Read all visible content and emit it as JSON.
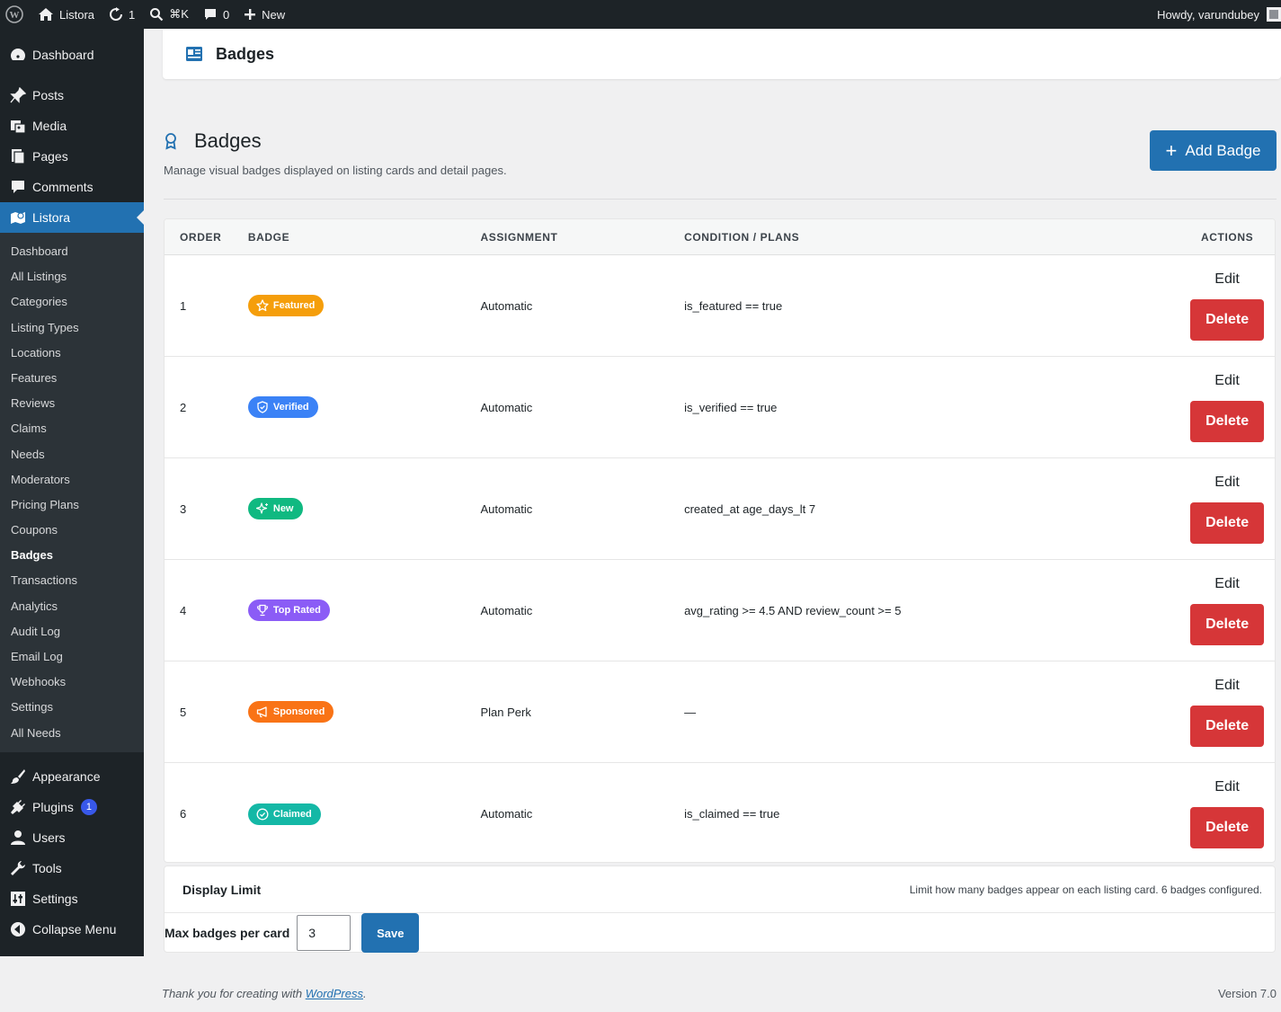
{
  "adminbar": {
    "site_name": "Listora",
    "updates_count": "1",
    "search_shortcut": "⌘K",
    "comments_count": "0",
    "new_label": "New",
    "greeting": "Howdy, varundubey"
  },
  "sidebar": {
    "top_items": [
      {
        "label": "Dashboard",
        "icon": "dashboard-icon"
      },
      {
        "label": "Posts",
        "icon": "pin-icon"
      },
      {
        "label": "Media",
        "icon": "media-icon"
      },
      {
        "label": "Pages",
        "icon": "pages-icon"
      },
      {
        "label": "Comments",
        "icon": "comment-icon"
      },
      {
        "label": "Listora",
        "icon": "map-icon"
      }
    ],
    "listora_submenu": [
      "Dashboard",
      "All Listings",
      "Categories",
      "Listing Types",
      "Locations",
      "Features",
      "Reviews",
      "Claims",
      "Needs",
      "Moderators",
      "Pricing Plans",
      "Coupons",
      "Badges",
      "Transactions",
      "Analytics",
      "Audit Log",
      "Email Log",
      "Webhooks",
      "Settings",
      "All Needs"
    ],
    "bottom_items": [
      {
        "label": "Appearance",
        "icon": "brush-icon"
      },
      {
        "label": "Plugins",
        "icon": "plug-icon",
        "count": "1"
      },
      {
        "label": "Users",
        "icon": "user-icon"
      },
      {
        "label": "Tools",
        "icon": "wrench-icon"
      },
      {
        "label": "Settings",
        "icon": "settings-icon"
      },
      {
        "label": "Collapse Menu",
        "icon": "collapse-icon"
      }
    ]
  },
  "header": {
    "title": "Badges"
  },
  "page": {
    "title": "Badges",
    "description": "Manage visual badges displayed on listing cards and detail pages.",
    "add_button": "Add Badge"
  },
  "table": {
    "columns": [
      "ORDER",
      "BADGE",
      "ASSIGNMENT",
      "CONDITION / PLANS",
      "ACTIONS"
    ],
    "rows": [
      {
        "order": "1",
        "badge": "Featured",
        "color": "#f59e0b",
        "icon": "star-icon",
        "assignment": "Automatic",
        "condition": "is_featured == true"
      },
      {
        "order": "2",
        "badge": "Verified",
        "color": "#3b82f6",
        "icon": "shield-icon",
        "assignment": "Automatic",
        "condition": "is_verified == true"
      },
      {
        "order": "3",
        "badge": "New",
        "color": "#10b981",
        "icon": "sparkle-icon",
        "assignment": "Automatic",
        "condition": "created_at age_days_lt 7"
      },
      {
        "order": "4",
        "badge": "Top Rated",
        "color": "#8b5cf6",
        "icon": "trophy-icon",
        "assignment": "Automatic",
        "condition": "avg_rating >= 4.5 AND review_count >= 5"
      },
      {
        "order": "5",
        "badge": "Sponsored",
        "color": "#f97316",
        "icon": "megaphone-icon",
        "assignment": "Plan Perk",
        "condition": "—"
      },
      {
        "order": "6",
        "badge": "Claimed",
        "color": "#14b8a6",
        "icon": "check-circle-icon",
        "assignment": "Automatic",
        "condition": "is_claimed == true"
      }
    ],
    "edit_label": "Edit",
    "delete_label": "Delete"
  },
  "limit": {
    "title": "Display Limit",
    "description": "Limit how many badges appear on each listing card. 6 badges configured.",
    "field_label": "Max badges per card",
    "value": "3",
    "save_label": "Save"
  },
  "footer": {
    "thanks_prefix": "Thank you for creating with ",
    "link": "WordPress",
    "suffix": ".",
    "version": "Version 7.0"
  }
}
